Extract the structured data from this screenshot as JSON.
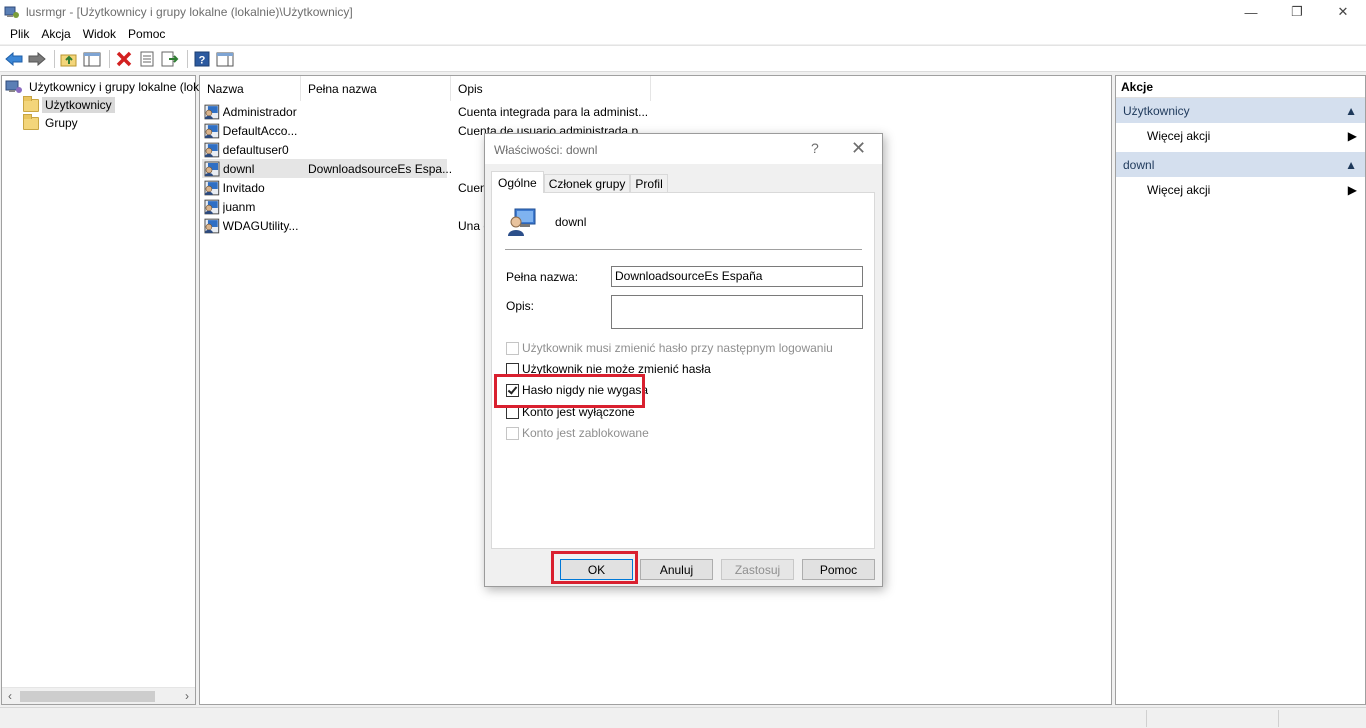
{
  "window": {
    "title": "lusrmgr - [Użytkownicy i grupy lokalne (lokalnie)\\Użytkownicy]",
    "minimize": "—",
    "restore": "❐",
    "close": "✕"
  },
  "menu": [
    "Plik",
    "Akcja",
    "Widok",
    "Pomoc"
  ],
  "tree": {
    "root": "Użytkownicy i grupy lokalne (lokalnie)",
    "items": [
      "Użytkownicy",
      "Grupy"
    ]
  },
  "list": {
    "columns": [
      "Nazwa",
      "Pełna nazwa",
      "Opis"
    ],
    "rows": [
      {
        "name": "Administrador",
        "full": "",
        "desc": "Cuenta integrada para la administ..."
      },
      {
        "name": "DefaultAcco...",
        "full": "",
        "desc": "Cuenta de usuario administrada p..."
      },
      {
        "name": "defaultuser0",
        "full": "",
        "desc": ""
      },
      {
        "name": "downl",
        "full": "DownloadsourceEs Espa...",
        "desc": ""
      },
      {
        "name": "Invitado",
        "full": "",
        "desc": "Cuen"
      },
      {
        "name": "juanm",
        "full": "",
        "desc": ""
      },
      {
        "name": "WDAGUtility...",
        "full": "",
        "desc": "Una c"
      }
    ]
  },
  "actions": {
    "title": "Akcje",
    "sections": [
      {
        "label": "Użytkownicy",
        "item": "Więcej akcji"
      },
      {
        "label": "downl",
        "item": "Więcej akcji"
      }
    ]
  },
  "dialog": {
    "title": "Właściwości: downl",
    "help": "?",
    "close": "✕",
    "tabs": [
      "Ogólne",
      "Członek grupy",
      "Profil"
    ],
    "username": "downl",
    "full_name_label": "Pełna nazwa:",
    "full_name_value": "DownloadsourceEs España",
    "desc_label": "Opis:",
    "desc_value": "",
    "checkboxes": [
      {
        "label": "Użytkownik musi zmienić hasło przy następnym logowaniu",
        "checked": false,
        "enabled": false
      },
      {
        "label": "Użytkownik nie może zmienić hasła",
        "checked": false,
        "enabled": true
      },
      {
        "label": "Hasło nigdy nie wygasa",
        "checked": true,
        "enabled": true
      },
      {
        "label": "Konto jest wyłączone",
        "checked": false,
        "enabled": true
      },
      {
        "label": "Konto jest zablokowane",
        "checked": false,
        "enabled": false
      }
    ],
    "buttons": {
      "ok": "OK",
      "cancel": "Anuluj",
      "apply": "Zastosuj",
      "help": "Pomoc"
    }
  },
  "colors": {
    "highlight": "#d9202f",
    "actions_section": "#d4dfee"
  }
}
